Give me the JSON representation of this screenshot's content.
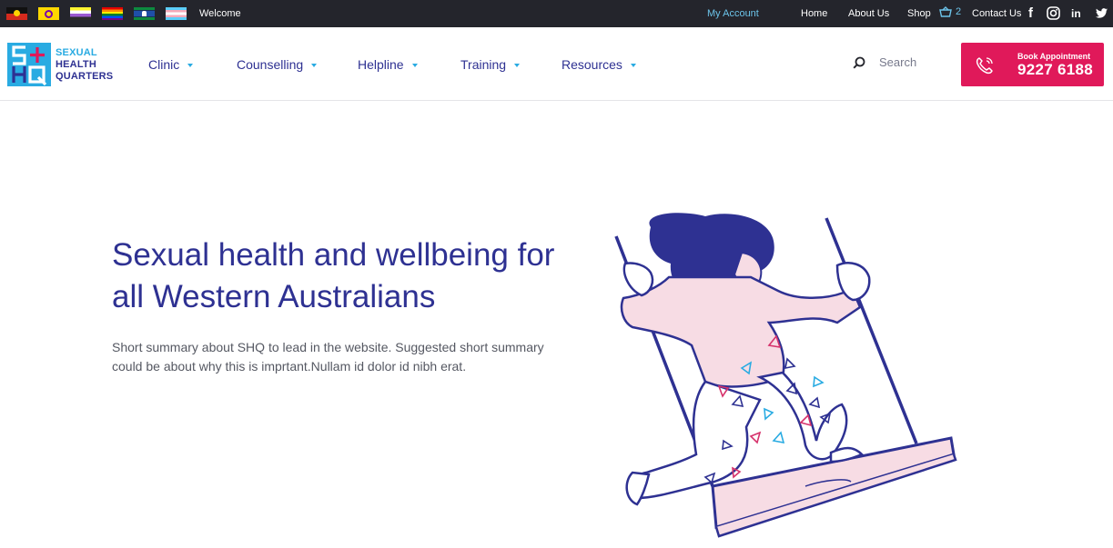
{
  "topbar": {
    "flags": [
      "aboriginal-flag",
      "intersex-flag",
      "nonbinary-flag",
      "rainbow-flag",
      "torres-strait-islander-flag",
      "transgender-flag"
    ],
    "welcome": "Welcome",
    "my_account": "My Account",
    "links": [
      "Home",
      "About Us",
      "Shop"
    ],
    "basket_count": "2",
    "contact": "Contact Us",
    "social": {
      "facebook": "f",
      "instagram": "instagram-icon",
      "linkedin": "in",
      "twitter": "twitter-icon"
    }
  },
  "logo": {
    "line1": "SEXUAL",
    "line2": "HEALTH",
    "line3": "QUARTERS"
  },
  "nav": {
    "items": [
      {
        "label": "Clinic"
      },
      {
        "label": "Counselling"
      },
      {
        "label": "Helpline"
      },
      {
        "label": "Training"
      },
      {
        "label": "Resources"
      }
    ]
  },
  "search": {
    "label": "Search"
  },
  "book": {
    "label": "Book Appointment",
    "number": "9227 6188"
  },
  "hero": {
    "title": "Sexual health and wellbeing for all Western Australians",
    "summary": "Short summary about SHQ to lead in the website. Suggested short summary could be about why this is imprtant.Nullam id dolor id nibh erat."
  },
  "colors": {
    "navy": "#2e3192",
    "cyan": "#29abe2",
    "pink": "#e0195a",
    "topbar": "#24252c",
    "swing_pink": "#f7dce4"
  }
}
